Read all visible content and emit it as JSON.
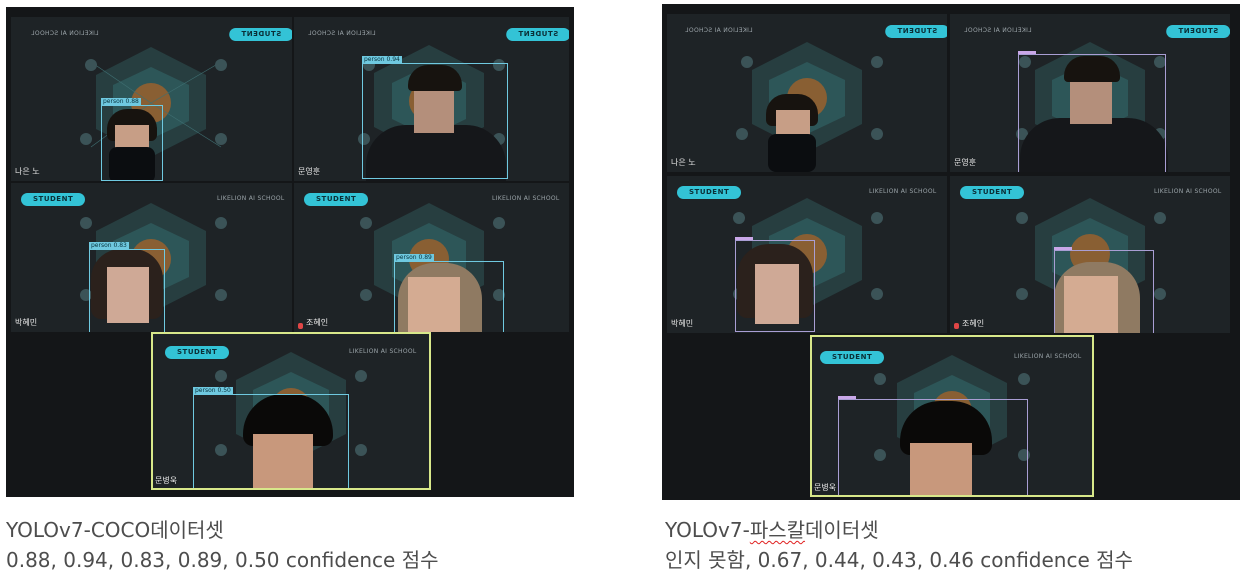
{
  "left": {
    "tiles": [
      {
        "badge": "STUDENT",
        "school": "LIKELION AI SCHOOL",
        "mirrored": true,
        "name": "나은 노",
        "label": "person 0.88"
      },
      {
        "badge": "STUDENT",
        "school": "LIKELION AI SCHOOL",
        "mirrored": true,
        "name": "문영훈",
        "label": "person 0.94"
      },
      {
        "badge": "STUDENT",
        "school": "LIKELION AI SCHOOL",
        "mirrored": false,
        "name": "박혜민",
        "label": "person 0.83"
      },
      {
        "badge": "STUDENT",
        "school": "LIKELION AI SCHOOL",
        "mirrored": false,
        "name": "조혜인",
        "label": "person 0.89"
      },
      {
        "badge": "STUDENT",
        "school": "LIKELION AI SCHOOL",
        "mirrored": false,
        "name": "문병욱",
        "label": "person 0.50"
      }
    ],
    "caption_line1": "YOLOv7-COCO데이터셋",
    "caption_line2": "0.88, 0.94, 0.83, 0.89, 0.50 confidence 점수"
  },
  "right": {
    "tiles": [
      {
        "badge": "STUDENT",
        "school": "LIKELION AI SCHOOL",
        "mirrored": true,
        "name": "나은 노"
      },
      {
        "badge": "STUDENT",
        "school": "LIKELION AI SCHOOL",
        "mirrored": true,
        "name": "문영훈"
      },
      {
        "badge": "STUDENT",
        "school": "LIKELION AI SCHOOL",
        "mirrored": false,
        "name": "박혜민"
      },
      {
        "badge": "STUDENT",
        "school": "LIKELION AI SCHOOL",
        "mirrored": false,
        "name": "조혜인"
      },
      {
        "badge": "STUDENT",
        "school": "LIKELION AI SCHOOL",
        "mirrored": false,
        "name": "문병욱"
      }
    ],
    "caption_prefix": "YOLOv7-",
    "caption_underlined": "파스칼",
    "caption_suffix": "데이터셋",
    "caption_line2": "인지 못함, 0.67, 0.44, 0.43, 0.46 confidence 점수"
  },
  "colors": {
    "badge": "#33c3d6",
    "highlight_border": "#d8e88a",
    "coco_box": "#6fc9e0",
    "pascal_box": "#a99ed4"
  }
}
